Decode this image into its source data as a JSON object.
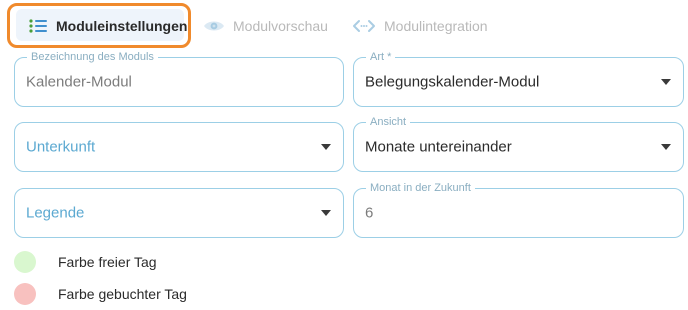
{
  "tabs": [
    {
      "label": "Moduleinstellungen",
      "icon": "list-icon",
      "active": true
    },
    {
      "label": "Modulvorschau",
      "icon": "eye-icon",
      "active": false
    },
    {
      "label": "Modulintegration",
      "icon": "code-icon",
      "active": false
    }
  ],
  "form": {
    "bezeichnung": {
      "legend": "Bezeichnung des Moduls",
      "value": "Kalender-Modul"
    },
    "art": {
      "legend": "Art *",
      "value": "Belegungskalender-Modul"
    },
    "unterkunft": {
      "placeholder": "Unterkunft"
    },
    "ansicht": {
      "legend": "Ansicht",
      "value": "Monate untereinander"
    },
    "legende": {
      "placeholder": "Legende"
    },
    "monat": {
      "legend": "Monat in der Zukunft",
      "value": "6"
    }
  },
  "colors": {
    "free_day": {
      "label": "Farbe freier Tag",
      "color": "#d9f7cf"
    },
    "booked_day": {
      "label": "Farbe gebuchter Tag",
      "color": "#f8c1bf"
    }
  },
  "accent": {
    "highlight": "#f08a2c",
    "border": "#9ccfe6",
    "placeholder": "#5ca9d1"
  }
}
